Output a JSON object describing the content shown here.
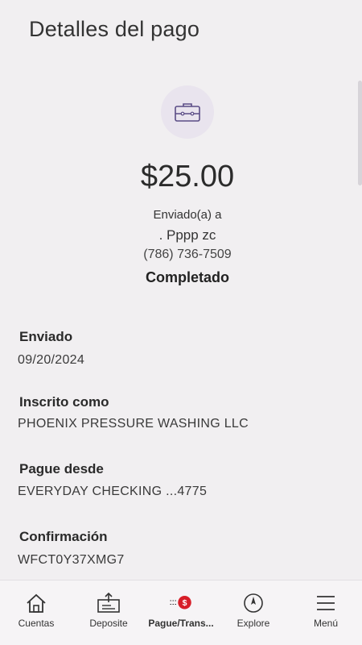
{
  "header": {
    "title": "Detalles del pago"
  },
  "payment": {
    "amount": "$25.00",
    "sent_to_label": "Enviado(a) a",
    "recipient": ". Pppp zc",
    "phone": "(786) 736-7509",
    "status": "Completado"
  },
  "details": {
    "sent_label": "Enviado",
    "sent_value": "09/20/2024",
    "enrolled_label": "Inscrito como",
    "enrolled_value": "PHOENIX PRESSURE WASHING LLC",
    "pay_from_label": "Pague desde",
    "pay_from_value": "EVERYDAY CHECKING ...4775",
    "confirmation_label": "Confirmación",
    "confirmation_value": "WFCT0Y37XMG7"
  },
  "nav": {
    "items": [
      {
        "label": "Cuentas",
        "icon": "home-icon"
      },
      {
        "label": "Deposite",
        "icon": "deposit-icon"
      },
      {
        "label": "Pague/Trans...",
        "icon": "pay-transfer-icon"
      },
      {
        "label": "Explore",
        "icon": "compass-icon"
      },
      {
        "label": "Menú",
        "icon": "menu-icon"
      }
    ]
  },
  "colors": {
    "accent_red": "#d71e28",
    "badge_purple": "#5b4d86"
  }
}
